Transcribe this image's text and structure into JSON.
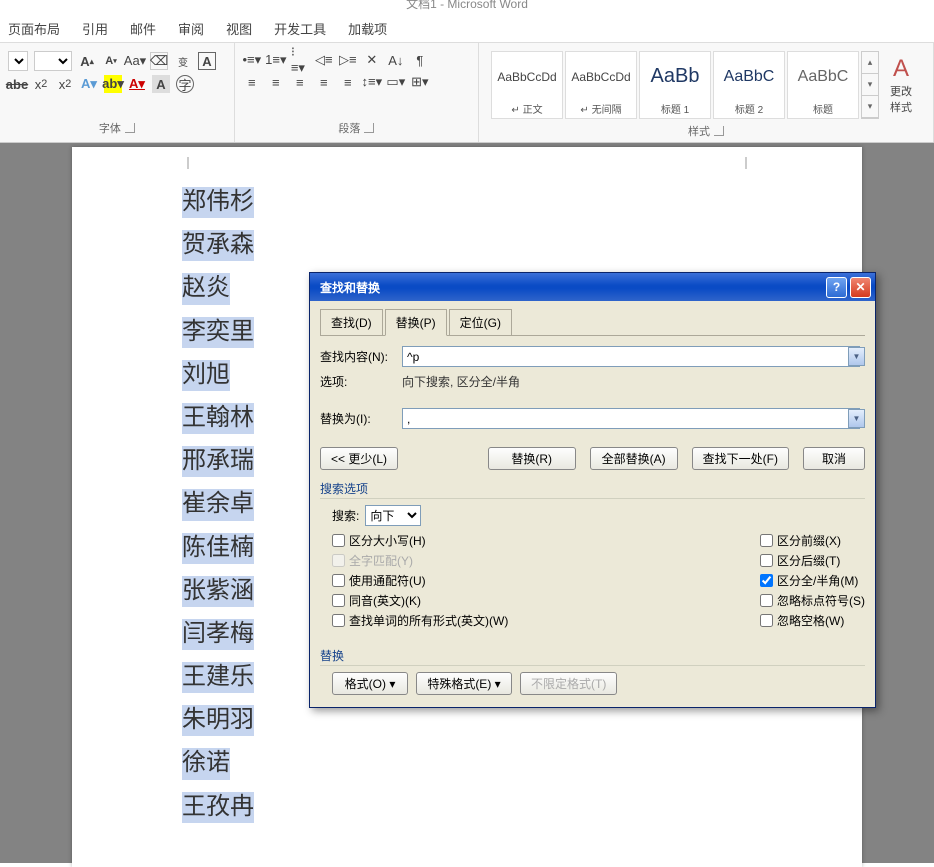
{
  "titlebar": "文档1 - Microsoft Word",
  "menu": {
    "layout": "页面布局",
    "ref": "引用",
    "mail": "邮件",
    "review": "审阅",
    "view": "视图",
    "dev": "开发工具",
    "addin": "加载项"
  },
  "ribbon": {
    "font_group": "字体",
    "para_group": "段落",
    "style_group": "样式",
    "change_styles": "更改样式",
    "styles": [
      {
        "preview": "AaBbCcDd",
        "name": "↵ 正文"
      },
      {
        "preview": "AaBbCcDd",
        "name": "↵ 无间隔"
      },
      {
        "preview": "AaBb",
        "name": "标题 1"
      },
      {
        "preview": "AaBbC",
        "name": "标题 2"
      },
      {
        "preview": "AaBbC",
        "name": "标题"
      }
    ]
  },
  "names": [
    "郑伟杉",
    "贺承森",
    "赵炎",
    "李奕里",
    "刘旭",
    "王翰林",
    "邢承瑞",
    "崔余卓",
    "陈佳楠",
    "张紫涵",
    "闫孝梅",
    "王建乐",
    "朱明羽",
    "徐诺",
    "王孜冉"
  ],
  "dialog": {
    "title": "查找和替换",
    "tabs": {
      "find": "查找(D)",
      "replace": "替换(P)",
      "goto": "定位(G)"
    },
    "find_label": "查找内容(N):",
    "find_value": "^p",
    "options_label": "选项:",
    "options_value": "向下搜索, 区分全/半角",
    "replace_label": "替换为(I):",
    "replace_value": ",",
    "btn_less": "<< 更少(L)",
    "btn_replace": "替换(R)",
    "btn_replace_all": "全部替换(A)",
    "btn_find_next": "查找下一处(F)",
    "btn_cancel": "取消",
    "search_options": "搜索选项",
    "search_label": "搜索:",
    "search_dir": "向下",
    "checks": {
      "case": "区分大小写(H)",
      "whole": "全字匹配(Y)",
      "wildcard": "使用通配符(U)",
      "sounds": "同音(英文)(K)",
      "forms": "查找单词的所有形式(英文)(W)",
      "prefix": "区分前缀(X)",
      "suffix": "区分后缀(T)",
      "width": "区分全/半角(M)",
      "punct": "忽略标点符号(S)",
      "space": "忽略空格(W)"
    },
    "replace_section": "替换",
    "btn_format": "格式(O) ▾",
    "btn_special": "特殊格式(E) ▾",
    "btn_noformat": "不限定格式(T)"
  }
}
